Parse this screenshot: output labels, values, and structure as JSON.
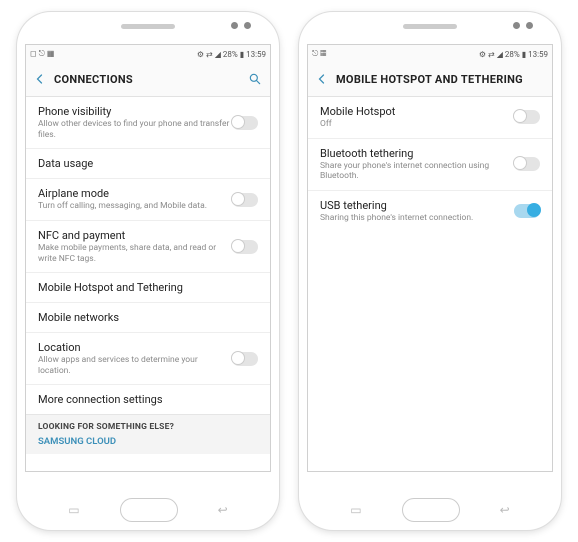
{
  "phones": [
    {
      "status": {
        "left_icons": "◻ ⎋ ▦",
        "right": "⚙ ⇄ ◢ 28% ▮ 13:59"
      },
      "header": {
        "title": "CONNECTIONS",
        "show_search": true
      },
      "rows": [
        {
          "label": "Phone visibility",
          "sub": "Allow other devices to find your phone and transfer files.",
          "toggle": "off"
        },
        {
          "label": "Data usage"
        },
        {
          "label": "Airplane mode",
          "sub": "Turn off calling, messaging, and Mobile data.",
          "toggle": "off"
        },
        {
          "label": "NFC and payment",
          "sub": "Make mobile payments, share data, and read or write NFC tags.",
          "toggle": "off"
        },
        {
          "label": "Mobile Hotspot and Tethering"
        },
        {
          "label": "Mobile networks"
        },
        {
          "label": "Location",
          "sub": "Allow apps and services to determine your location.",
          "toggle": "off"
        },
        {
          "label": "More connection settings"
        }
      ],
      "footer": {
        "question": "LOOKING FOR SOMETHING ELSE?",
        "link": "SAMSUNG CLOUD"
      }
    },
    {
      "status": {
        "left_icons": "⎋ ▦",
        "right": "⚙ ⇄ ◢ 28% ▮ 13:59"
      },
      "header": {
        "title": "MOBILE HOTSPOT AND TETHERING",
        "show_search": false
      },
      "rows": [
        {
          "label": "Mobile Hotspot",
          "sub": "Off",
          "toggle": "off"
        },
        {
          "label": "Bluetooth tethering",
          "sub": "Share your phone's internet connection using Bluetooth.",
          "toggle": "off"
        },
        {
          "label": "USB tethering",
          "sub": "Sharing this phone's internet connection.",
          "toggle": "on"
        }
      ]
    }
  ]
}
